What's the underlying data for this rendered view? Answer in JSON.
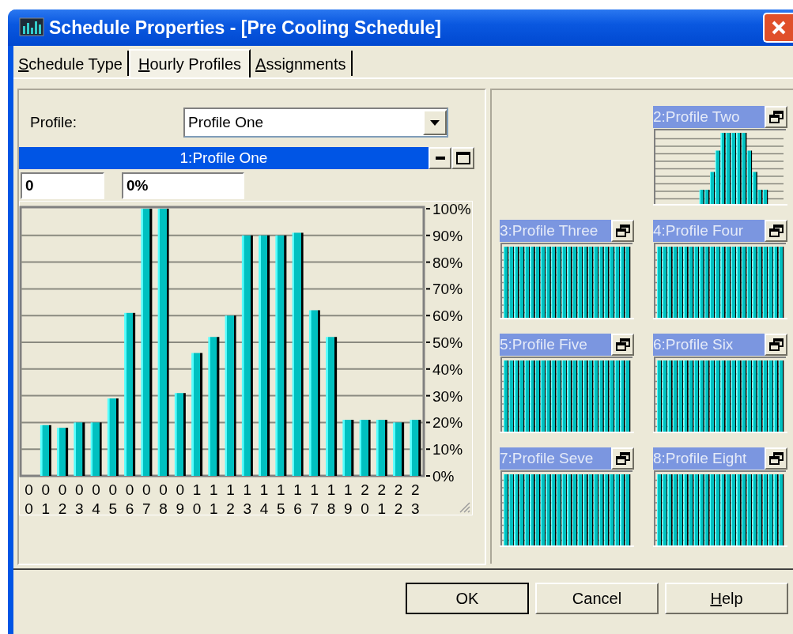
{
  "window": {
    "title": "Schedule Properties - [Pre Cooling Schedule]"
  },
  "tabs": [
    {
      "label": "Schedule Type",
      "mnemonic": true,
      "selected": false
    },
    {
      "label": "Hourly Profiles",
      "mnemonic": true,
      "selected": true
    },
    {
      "label": "Assignments",
      "mnemonic": true,
      "selected": false
    }
  ],
  "profile_field": {
    "label": "Profile:",
    "value": "Profile One"
  },
  "profile_chart": {
    "title": "1:Profile One",
    "hour_field": "0",
    "value_field": "0%",
    "chart_data": {
      "type": "bar",
      "categories": [
        "00",
        "01",
        "02",
        "03",
        "04",
        "05",
        "06",
        "07",
        "08",
        "09",
        "10",
        "11",
        "12",
        "13",
        "14",
        "15",
        "16",
        "17",
        "18",
        "19",
        "20",
        "21",
        "22",
        "23"
      ],
      "values": [
        0,
        19,
        18,
        20,
        20,
        29,
        61,
        100,
        100,
        31,
        46,
        52,
        60,
        90,
        90,
        90,
        91,
        62,
        52,
        21,
        21,
        21,
        20,
        21
      ],
      "ylim": [
        0,
        100
      ],
      "grid": true,
      "yticks": [
        {
          "value": 0,
          "label": "0%"
        },
        {
          "value": 10,
          "label": "10%"
        },
        {
          "value": 20,
          "label": "20%"
        },
        {
          "value": 30,
          "label": "30%"
        },
        {
          "value": 40,
          "label": "40%"
        },
        {
          "value": 50,
          "label": "50%"
        },
        {
          "value": 60,
          "label": "60%"
        },
        {
          "value": 70,
          "label": "70%"
        },
        {
          "value": 80,
          "label": "80%"
        },
        {
          "value": 90,
          "label": "90%"
        },
        {
          "value": 100,
          "label": "100%"
        }
      ]
    }
  },
  "profile_thumbnails": [
    {
      "title": "2:Profile Two",
      "kind": "peaked"
    },
    {
      "title": "3:Profile Three",
      "kind": "flat"
    },
    {
      "title": "4:Profile Four",
      "kind": "flat"
    },
    {
      "title": "5:Profile Five",
      "kind": "flat"
    },
    {
      "title": "6:Profile Six",
      "kind": "flat"
    },
    {
      "title": "7:Profile Seve",
      "kind": "flat"
    },
    {
      "title": "8:Profile Eight",
      "kind": "flat"
    }
  ],
  "buttons": [
    {
      "label": "OK",
      "default": true,
      "mnemonic": false
    },
    {
      "label": "Cancel",
      "default": false,
      "mnemonic": false
    },
    {
      "label": "Help",
      "default": false,
      "mnemonic": true
    }
  ]
}
